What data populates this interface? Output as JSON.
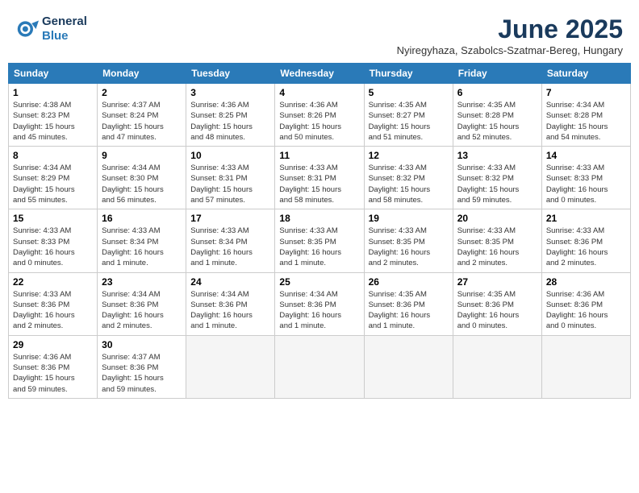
{
  "logo": {
    "line1": "General",
    "line2": "Blue"
  },
  "title": "June 2025",
  "subtitle": "Nyiregyhaza, Szabolcs-Szatmar-Bereg, Hungary",
  "days_of_week": [
    "Sunday",
    "Monday",
    "Tuesday",
    "Wednesday",
    "Thursday",
    "Friday",
    "Saturday"
  ],
  "weeks": [
    [
      {
        "day": "1",
        "info": "Sunrise: 4:38 AM\nSunset: 8:23 PM\nDaylight: 15 hours\nand 45 minutes."
      },
      {
        "day": "2",
        "info": "Sunrise: 4:37 AM\nSunset: 8:24 PM\nDaylight: 15 hours\nand 47 minutes."
      },
      {
        "day": "3",
        "info": "Sunrise: 4:36 AM\nSunset: 8:25 PM\nDaylight: 15 hours\nand 48 minutes."
      },
      {
        "day": "4",
        "info": "Sunrise: 4:36 AM\nSunset: 8:26 PM\nDaylight: 15 hours\nand 50 minutes."
      },
      {
        "day": "5",
        "info": "Sunrise: 4:35 AM\nSunset: 8:27 PM\nDaylight: 15 hours\nand 51 minutes."
      },
      {
        "day": "6",
        "info": "Sunrise: 4:35 AM\nSunset: 8:28 PM\nDaylight: 15 hours\nand 52 minutes."
      },
      {
        "day": "7",
        "info": "Sunrise: 4:34 AM\nSunset: 8:28 PM\nDaylight: 15 hours\nand 54 minutes."
      }
    ],
    [
      {
        "day": "8",
        "info": "Sunrise: 4:34 AM\nSunset: 8:29 PM\nDaylight: 15 hours\nand 55 minutes."
      },
      {
        "day": "9",
        "info": "Sunrise: 4:34 AM\nSunset: 8:30 PM\nDaylight: 15 hours\nand 56 minutes."
      },
      {
        "day": "10",
        "info": "Sunrise: 4:33 AM\nSunset: 8:31 PM\nDaylight: 15 hours\nand 57 minutes."
      },
      {
        "day": "11",
        "info": "Sunrise: 4:33 AM\nSunset: 8:31 PM\nDaylight: 15 hours\nand 58 minutes."
      },
      {
        "day": "12",
        "info": "Sunrise: 4:33 AM\nSunset: 8:32 PM\nDaylight: 15 hours\nand 58 minutes."
      },
      {
        "day": "13",
        "info": "Sunrise: 4:33 AM\nSunset: 8:32 PM\nDaylight: 15 hours\nand 59 minutes."
      },
      {
        "day": "14",
        "info": "Sunrise: 4:33 AM\nSunset: 8:33 PM\nDaylight: 16 hours\nand 0 minutes."
      }
    ],
    [
      {
        "day": "15",
        "info": "Sunrise: 4:33 AM\nSunset: 8:33 PM\nDaylight: 16 hours\nand 0 minutes."
      },
      {
        "day": "16",
        "info": "Sunrise: 4:33 AM\nSunset: 8:34 PM\nDaylight: 16 hours\nand 1 minute."
      },
      {
        "day": "17",
        "info": "Sunrise: 4:33 AM\nSunset: 8:34 PM\nDaylight: 16 hours\nand 1 minute."
      },
      {
        "day": "18",
        "info": "Sunrise: 4:33 AM\nSunset: 8:35 PM\nDaylight: 16 hours\nand 1 minute."
      },
      {
        "day": "19",
        "info": "Sunrise: 4:33 AM\nSunset: 8:35 PM\nDaylight: 16 hours\nand 2 minutes."
      },
      {
        "day": "20",
        "info": "Sunrise: 4:33 AM\nSunset: 8:35 PM\nDaylight: 16 hours\nand 2 minutes."
      },
      {
        "day": "21",
        "info": "Sunrise: 4:33 AM\nSunset: 8:36 PM\nDaylight: 16 hours\nand 2 minutes."
      }
    ],
    [
      {
        "day": "22",
        "info": "Sunrise: 4:33 AM\nSunset: 8:36 PM\nDaylight: 16 hours\nand 2 minutes."
      },
      {
        "day": "23",
        "info": "Sunrise: 4:34 AM\nSunset: 8:36 PM\nDaylight: 16 hours\nand 2 minutes."
      },
      {
        "day": "24",
        "info": "Sunrise: 4:34 AM\nSunset: 8:36 PM\nDaylight: 16 hours\nand 1 minute."
      },
      {
        "day": "25",
        "info": "Sunrise: 4:34 AM\nSunset: 8:36 PM\nDaylight: 16 hours\nand 1 minute."
      },
      {
        "day": "26",
        "info": "Sunrise: 4:35 AM\nSunset: 8:36 PM\nDaylight: 16 hours\nand 1 minute."
      },
      {
        "day": "27",
        "info": "Sunrise: 4:35 AM\nSunset: 8:36 PM\nDaylight: 16 hours\nand 0 minutes."
      },
      {
        "day": "28",
        "info": "Sunrise: 4:36 AM\nSunset: 8:36 PM\nDaylight: 16 hours\nand 0 minutes."
      }
    ],
    [
      {
        "day": "29",
        "info": "Sunrise: 4:36 AM\nSunset: 8:36 PM\nDaylight: 15 hours\nand 59 minutes."
      },
      {
        "day": "30",
        "info": "Sunrise: 4:37 AM\nSunset: 8:36 PM\nDaylight: 15 hours\nand 59 minutes."
      },
      {
        "day": "",
        "info": ""
      },
      {
        "day": "",
        "info": ""
      },
      {
        "day": "",
        "info": ""
      },
      {
        "day": "",
        "info": ""
      },
      {
        "day": "",
        "info": ""
      }
    ]
  ]
}
